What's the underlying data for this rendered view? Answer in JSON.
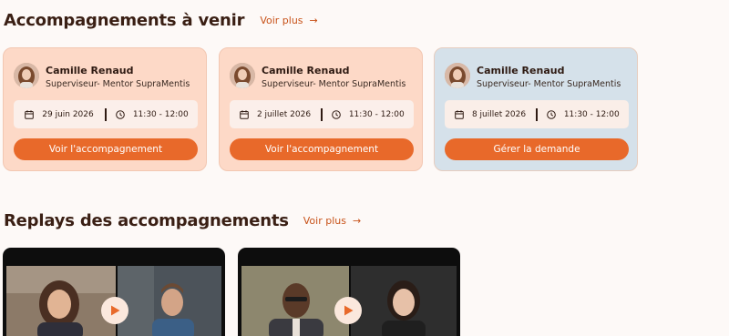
{
  "upcoming": {
    "title": "Accompagnements à venir",
    "more_label": "Voir plus",
    "cards": [
      {
        "name": "Camille Renaud",
        "role": "Superviseur- Mentor SupraMentis",
        "date": "29 juin 2026",
        "time": "11:30 - 12:00",
        "button": "Voir l'accompagnement",
        "bg": "#fdd9c7"
      },
      {
        "name": "Camille Renaud",
        "role": "Superviseur- Mentor SupraMentis",
        "date": "2 juillet 2026",
        "time": "11:30 - 12:00",
        "button": "Voir l'accompagnement",
        "bg": "#fdd9c7"
      },
      {
        "name": "Camille Renaud",
        "role": "Superviseur- Mentor SupraMentis",
        "date": "8 juillet 2026",
        "time": "11:30 - 12:00",
        "button": "Gérer la demande",
        "bg": "#d5e1ea"
      }
    ]
  },
  "replays": {
    "title": "Replays des accompagnements",
    "more_label": "Voir plus"
  },
  "colors": {
    "accent": "#e8692a",
    "link": "#c8531a",
    "heading": "#3a1f14",
    "background": "#fdf9f7"
  }
}
